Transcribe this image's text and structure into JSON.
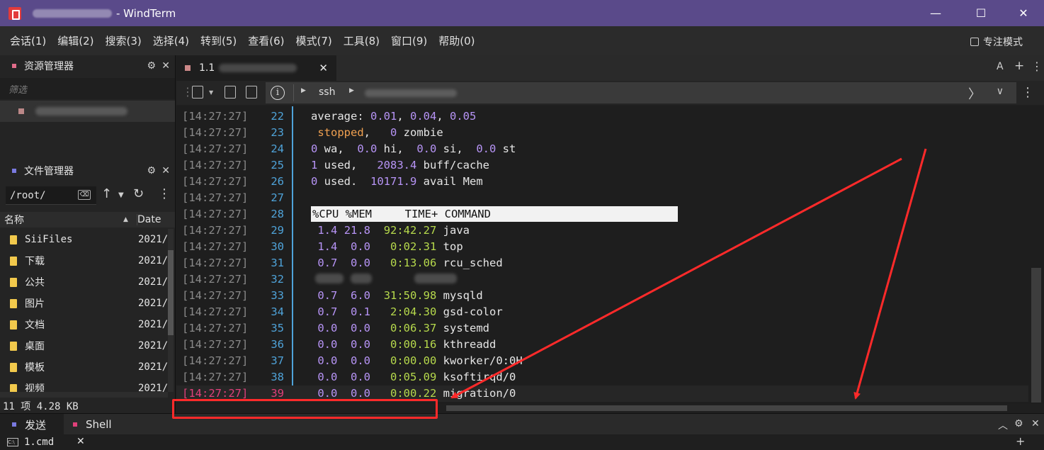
{
  "window": {
    "title": "- WindTerm",
    "controls": {
      "minimize": "—",
      "maximize": "☐",
      "close": "✕"
    }
  },
  "menu": {
    "items": [
      "会话(1)",
      "编辑(2)",
      "搜索(3)",
      "选择(4)",
      "转到(5)",
      "查看(6)",
      "模式(7)",
      "工具(8)",
      "窗口(9)",
      "帮助(0)"
    ],
    "focus_mode": "专注模式"
  },
  "resource_panel": {
    "title": "资源管理器",
    "filter_placeholder": "筛选",
    "marker_color": "#e06c8a"
  },
  "file_panel": {
    "title": "文件管理器",
    "path": "/root/",
    "clear_icon": "⌫",
    "columns": {
      "name": "名称",
      "date": "Date"
    },
    "files": [
      {
        "name": "SiiFiles",
        "date": "2021/"
      },
      {
        "name": "下载",
        "date": "2021/"
      },
      {
        "name": "公共",
        "date": "2021/"
      },
      {
        "name": "图片",
        "date": "2021/"
      },
      {
        "name": "文档",
        "date": "2021/"
      },
      {
        "name": "桌面",
        "date": "2021/"
      },
      {
        "name": "模板",
        "date": "2021/"
      },
      {
        "name": "视频",
        "date": "2021/"
      }
    ],
    "status": "11 项 4.28 KB",
    "marker_color": "#7a7ae0"
  },
  "tabs": {
    "session_label": "1.1",
    "close": "✕",
    "right_icons": {
      "font": "A",
      "add": "+",
      "menu": "⋮"
    }
  },
  "address": {
    "protocol": "ssh",
    "info_icon": "i",
    "next": "〉",
    "dropdown": "∨"
  },
  "terminal": {
    "lines": [
      {
        "ts": "[14:27:27]",
        "ln": "22",
        "parts": [
          [
            "t",
            "average: "
          ],
          [
            "n",
            "0.01"
          ],
          [
            "t",
            ", "
          ],
          [
            "n",
            "0.04"
          ],
          [
            "t",
            ", "
          ],
          [
            "n",
            "0.05"
          ]
        ]
      },
      {
        "ts": "[14:27:27]",
        "ln": "23",
        "parts": [
          [
            "t",
            " "
          ],
          [
            "o",
            "stopped"
          ],
          [
            "t",
            ",   "
          ],
          [
            "n",
            "0"
          ],
          [
            "t",
            " zombie"
          ]
        ]
      },
      {
        "ts": "[14:27:27]",
        "ln": "24",
        "parts": [
          [
            "n",
            "0"
          ],
          [
            "t",
            " wa,  "
          ],
          [
            "n",
            "0.0"
          ],
          [
            "t",
            " hi,  "
          ],
          [
            "n",
            "0.0"
          ],
          [
            "t",
            " si,  "
          ],
          [
            "n",
            "0.0"
          ],
          [
            "t",
            " st"
          ]
        ]
      },
      {
        "ts": "[14:27:27]",
        "ln": "25",
        "parts": [
          [
            "n",
            "1"
          ],
          [
            "t",
            " used,   "
          ],
          [
            "n",
            "2083.4"
          ],
          [
            "t",
            " buff/cache"
          ]
        ]
      },
      {
        "ts": "[14:27:27]",
        "ln": "26",
        "parts": [
          [
            "n",
            "0"
          ],
          [
            "t",
            " used.  "
          ],
          [
            "n",
            "10171.9"
          ],
          [
            "t",
            " avail Mem"
          ]
        ]
      },
      {
        "ts": "[14:27:27]",
        "ln": "27",
        "parts": []
      },
      {
        "ts": "[14:27:27]",
        "ln": "28",
        "parts": []
      },
      {
        "ts": "[14:27:27]",
        "ln": "29",
        "parts": [
          [
            "t",
            " "
          ],
          [
            "n",
            "1.4"
          ],
          [
            "t",
            " "
          ],
          [
            "n",
            "21.8"
          ],
          [
            "t",
            "  "
          ],
          [
            "g",
            "92:42.27"
          ],
          [
            "t",
            " java"
          ]
        ]
      },
      {
        "ts": "[14:27:27]",
        "ln": "30",
        "parts": [
          [
            "t",
            " "
          ],
          [
            "n",
            "1.4"
          ],
          [
            "t",
            "  "
          ],
          [
            "n",
            "0.0"
          ],
          [
            "t",
            "   "
          ],
          [
            "g",
            "0:02.31"
          ],
          [
            "t",
            " top"
          ]
        ]
      },
      {
        "ts": "[14:27:27]",
        "ln": "31",
        "parts": [
          [
            "t",
            " "
          ],
          [
            "n",
            "0.7"
          ],
          [
            "t",
            "  "
          ],
          [
            "n",
            "0.0"
          ],
          [
            "t",
            "   "
          ],
          [
            "g",
            "0:13.06"
          ],
          [
            "t",
            " rcu_sched"
          ]
        ]
      },
      {
        "ts": "[14:27:27]",
        "ln": "32",
        "parts": []
      },
      {
        "ts": "[14:27:27]",
        "ln": "33",
        "parts": [
          [
            "t",
            " "
          ],
          [
            "n",
            "0.7"
          ],
          [
            "t",
            "  "
          ],
          [
            "n",
            "6.0"
          ],
          [
            "t",
            "  "
          ],
          [
            "g",
            "31:50.98"
          ],
          [
            "t",
            " mysqld"
          ]
        ]
      },
      {
        "ts": "[14:27:27]",
        "ln": "34",
        "parts": [
          [
            "t",
            " "
          ],
          [
            "n",
            "0.7"
          ],
          [
            "t",
            "  "
          ],
          [
            "n",
            "0.1"
          ],
          [
            "t",
            "   "
          ],
          [
            "g",
            "2:04.30"
          ],
          [
            "t",
            " gsd-color"
          ]
        ]
      },
      {
        "ts": "[14:27:27]",
        "ln": "35",
        "parts": [
          [
            "t",
            " "
          ],
          [
            "n",
            "0.0"
          ],
          [
            "t",
            "  "
          ],
          [
            "n",
            "0.0"
          ],
          [
            "t",
            "   "
          ],
          [
            "g",
            "0:06.37"
          ],
          [
            "t",
            " systemd"
          ]
        ]
      },
      {
        "ts": "[14:27:27]",
        "ln": "36",
        "parts": [
          [
            "t",
            " "
          ],
          [
            "n",
            "0.0"
          ],
          [
            "t",
            "  "
          ],
          [
            "n",
            "0.0"
          ],
          [
            "t",
            "   "
          ],
          [
            "g",
            "0:00.16"
          ],
          [
            "t",
            " kthreadd"
          ]
        ]
      },
      {
        "ts": "[14:27:27]",
        "ln": "37",
        "parts": [
          [
            "t",
            " "
          ],
          [
            "n",
            "0.0"
          ],
          [
            "t",
            "  "
          ],
          [
            "n",
            "0.0"
          ],
          [
            "t",
            "   "
          ],
          [
            "g",
            "0:00.00"
          ],
          [
            "t",
            " kworker/0:0H"
          ]
        ]
      },
      {
        "ts": "[14:27:27]",
        "ln": "38",
        "parts": [
          [
            "t",
            " "
          ],
          [
            "n",
            "0.0"
          ],
          [
            "t",
            "  "
          ],
          [
            "n",
            "0.0"
          ],
          [
            "t",
            "   "
          ],
          [
            "g",
            "0:05.09"
          ],
          [
            "t",
            " ksoftirqd/0"
          ]
        ]
      },
      {
        "ts": "[14:27:27]",
        "ln": "39",
        "parts": [
          [
            "t",
            " "
          ],
          [
            "n",
            "0.0"
          ],
          [
            "t",
            "  "
          ],
          [
            "n",
            "0.0"
          ],
          [
            "t",
            "   "
          ],
          [
            "g",
            "0:00.22"
          ],
          [
            "t",
            " migration/0"
          ]
        ]
      }
    ],
    "header": "%CPU %MEM     TIME+ COMMAND",
    "colors": {
      "number": "#b794f6",
      "time": "#b6d94c",
      "stopped": "#f0a050",
      "line_number": "#4fa3d9",
      "current": "#e0407a"
    }
  },
  "bottom": {
    "tabs": [
      {
        "label": "发送",
        "color": "#7a7ae0"
      },
      {
        "label": "Shell",
        "color": "#e0407a"
      }
    ],
    "right_icons": {
      "collapse": "︿",
      "gear": "⚙",
      "close": "✕"
    },
    "cmd_tab": "1.cmd",
    "cmd_icon": "C:\\",
    "cmd_close": "✕",
    "add": "+"
  },
  "annotation": {
    "color": "#ff2a2a"
  }
}
